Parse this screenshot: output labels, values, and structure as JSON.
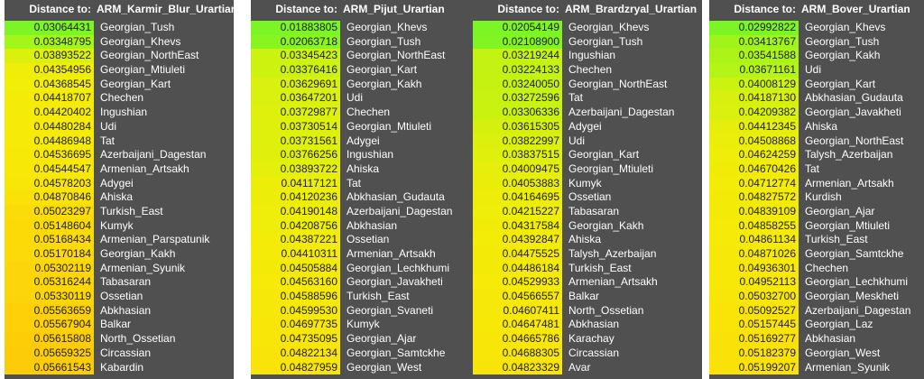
{
  "header_label": "Distance to:",
  "panels": [
    {
      "population": "ARM_Karmir_Blur_Urartian",
      "rows": [
        {
          "value": "0.03064431",
          "name": "Georgian_Tush",
          "color": "#7cf524"
        },
        {
          "value": "0.03348795",
          "name": "Georgian_Khevs",
          "color": "#a4f51a"
        },
        {
          "value": "0.03893522",
          "name": "Georgian_NorthEast",
          "color": "#dcf00e"
        },
        {
          "value": "0.04354956",
          "name": "Georgian_Mtiuleti",
          "color": "#f0ee08"
        },
        {
          "value": "0.04368545",
          "name": "Georgian_Kart",
          "color": "#f2ee08"
        },
        {
          "value": "0.04418707",
          "name": "Chechen",
          "color": "#f4ec08"
        },
        {
          "value": "0.04420402",
          "name": "Ingushian",
          "color": "#f4ec08"
        },
        {
          "value": "0.04480284",
          "name": "Udi",
          "color": "#f6ea08"
        },
        {
          "value": "0.04486948",
          "name": "Tat",
          "color": "#f6ea08"
        },
        {
          "value": "0.04536695",
          "name": "Azerbaijani_Dagestan",
          "color": "#f8e808"
        },
        {
          "value": "0.04544547",
          "name": "Armenian_Artsakh",
          "color": "#f8e808"
        },
        {
          "value": "0.04578203",
          "name": "Adygei",
          "color": "#f8e608"
        },
        {
          "value": "0.04870846",
          "name": "Ahiska",
          "color": "#fae208"
        },
        {
          "value": "0.05023297",
          "name": "Turkish_East",
          "color": "#fcdc08"
        },
        {
          "value": "0.05148604",
          "name": "Kumyk",
          "color": "#fcda08"
        },
        {
          "value": "0.05168434",
          "name": "Armenian_Parspatunik",
          "color": "#fcda08"
        },
        {
          "value": "0.05170184",
          "name": "Georgian_Kakh",
          "color": "#fcd908"
        },
        {
          "value": "0.05302119",
          "name": "Armenian_Syunik",
          "color": "#fcd608"
        },
        {
          "value": "0.05316244",
          "name": "Tabasaran",
          "color": "#fcd608"
        },
        {
          "value": "0.05330119",
          "name": "Ossetian",
          "color": "#fcd508"
        },
        {
          "value": "0.05563659",
          "name": "Abkhasian",
          "color": "#fdd008"
        },
        {
          "value": "0.05567904",
          "name": "Balkar",
          "color": "#fdd008"
        },
        {
          "value": "0.05615808",
          "name": "North_Ossetian",
          "color": "#fdce08"
        },
        {
          "value": "0.05659325",
          "name": "Circassian",
          "color": "#fdcc08"
        },
        {
          "value": "0.05661543",
          "name": "Kabardin",
          "color": "#fdcc08"
        }
      ]
    },
    {
      "population": "ARM_Pijut_Urartian",
      "rows": [
        {
          "value": "0.01883805",
          "name": "Georgian_Khevs",
          "color": "#7cf524"
        },
        {
          "value": "0.02063718",
          "name": "Georgian_Tush",
          "color": "#88f520"
        },
        {
          "value": "0.03345423",
          "name": "Georgian_NorthEast",
          "color": "#ccf210"
        },
        {
          "value": "0.03376416",
          "name": "Georgian_Kart",
          "color": "#cef210"
        },
        {
          "value": "0.03629691",
          "name": "Georgian_Kakh",
          "color": "#daf00e"
        },
        {
          "value": "0.03647201",
          "name": "Udi",
          "color": "#daf00e"
        },
        {
          "value": "0.03729877",
          "name": "Chechen",
          "color": "#def00c"
        },
        {
          "value": "0.03730514",
          "name": "Georgian_Mtiuleti",
          "color": "#def00c"
        },
        {
          "value": "0.03731561",
          "name": "Adygei",
          "color": "#def00c"
        },
        {
          "value": "0.03766256",
          "name": "Ingushian",
          "color": "#e0f00c"
        },
        {
          "value": "0.03893722",
          "name": "Ahiska",
          "color": "#e4f00c"
        },
        {
          "value": "0.04117121",
          "name": "Tat",
          "color": "#ecee0a"
        },
        {
          "value": "0.04120236",
          "name": "Abkhasian_Gudauta",
          "color": "#ecee0a"
        },
        {
          "value": "0.04190148",
          "name": "Azerbaijani_Dagestan",
          "color": "#eeee0a"
        },
        {
          "value": "0.04208756",
          "name": "Abkhasian",
          "color": "#eeee0a"
        },
        {
          "value": "0.04387221",
          "name": "Ossetian",
          "color": "#f2ec08"
        },
        {
          "value": "0.04410311",
          "name": "Armenian_Artsakh",
          "color": "#f4ec08"
        },
        {
          "value": "0.04505884",
          "name": "Georgian_Lechkhumi",
          "color": "#f4ea08"
        },
        {
          "value": "0.04563160",
          "name": "Georgian_Javakheti",
          "color": "#f6ea08"
        },
        {
          "value": "0.04588596",
          "name": "Turkish_East",
          "color": "#f6e808"
        },
        {
          "value": "0.04599530",
          "name": "Georgian_Svaneti",
          "color": "#f6e808"
        },
        {
          "value": "0.04697735",
          "name": "Kumyk",
          "color": "#f8e608"
        },
        {
          "value": "0.04735095",
          "name": "Georgian_Ajar",
          "color": "#f8e608"
        },
        {
          "value": "0.04822134",
          "name": "Georgian_Samtckhe",
          "color": "#f8e408"
        },
        {
          "value": "0.04827959",
          "name": "Georgian_West",
          "color": "#f8e408"
        }
      ]
    },
    {
      "population": "ARM_Brardzryal_Urartian",
      "rows": [
        {
          "value": "0.02054149",
          "name": "Georgian_Khevs",
          "color": "#7cf524"
        },
        {
          "value": "0.02108900",
          "name": "Georgian_Tush",
          "color": "#80f522"
        },
        {
          "value": "0.03219244",
          "name": "Ingushian",
          "color": "#c4f212"
        },
        {
          "value": "0.03224133",
          "name": "Chechen",
          "color": "#c4f212"
        },
        {
          "value": "0.03240050",
          "name": "Georgian_NorthEast",
          "color": "#c6f212"
        },
        {
          "value": "0.03272596",
          "name": "Tat",
          "color": "#c8f212"
        },
        {
          "value": "0.03306336",
          "name": "Azerbaijani_Dagestan",
          "color": "#caf210"
        },
        {
          "value": "0.03615305",
          "name": "Adygei",
          "color": "#d6f00e"
        },
        {
          "value": "0.03822997",
          "name": "Udi",
          "color": "#dcf00e"
        },
        {
          "value": "0.03837515",
          "name": "Georgian_Kart",
          "color": "#def00c"
        },
        {
          "value": "0.04009475",
          "name": "Georgian_Mtiuleti",
          "color": "#e6ee0c"
        },
        {
          "value": "0.04053883",
          "name": "Kumyk",
          "color": "#e8ee0a"
        },
        {
          "value": "0.04164695",
          "name": "Ossetian",
          "color": "#ecee0a"
        },
        {
          "value": "0.04215227",
          "name": "Tabasaran",
          "color": "#eeee0a"
        },
        {
          "value": "0.04317584",
          "name": "Georgian_Kakh",
          "color": "#f0ec08"
        },
        {
          "value": "0.04392847",
          "name": "Ahiska",
          "color": "#f2ec08"
        },
        {
          "value": "0.04475525",
          "name": "Talysh_Azerbaijan",
          "color": "#f4ea08"
        },
        {
          "value": "0.04486184",
          "name": "Turkish_East",
          "color": "#f4ea08"
        },
        {
          "value": "0.04529933",
          "name": "Armenian_Artsakh",
          "color": "#f6ea08"
        },
        {
          "value": "0.04566557",
          "name": "Balkar",
          "color": "#f6e808"
        },
        {
          "value": "0.04607411",
          "name": "North_Ossetian",
          "color": "#f6e808"
        },
        {
          "value": "0.04647481",
          "name": "Abkhasian",
          "color": "#f8e808"
        },
        {
          "value": "0.04665786",
          "name": "Karachay",
          "color": "#f8e608"
        },
        {
          "value": "0.04688305",
          "name": "Circassian",
          "color": "#f8e608"
        },
        {
          "value": "0.04823329",
          "name": "Avar",
          "color": "#f8e408"
        }
      ]
    },
    {
      "population": "ARM_Bover_Urartian",
      "rows": [
        {
          "value": "0.02992822",
          "name": "Georgian_Khevs",
          "color": "#7cf524"
        },
        {
          "value": "0.03413767",
          "name": "Georgian_Tush",
          "color": "#a0f41a"
        },
        {
          "value": "0.03541588",
          "name": "Georgian_Kakh",
          "color": "#acf418"
        },
        {
          "value": "0.03671161",
          "name": "Udi",
          "color": "#b4f416"
        },
        {
          "value": "0.04008129",
          "name": "Georgian_Kart",
          "color": "#ccf210"
        },
        {
          "value": "0.04187130",
          "name": "Abkhasian_Gudauta",
          "color": "#d8f00e"
        },
        {
          "value": "0.04209382",
          "name": "Georgian_Javakheti",
          "color": "#daf00e"
        },
        {
          "value": "0.04412345",
          "name": "Ahiska",
          "color": "#e6ee0c"
        },
        {
          "value": "0.04508868",
          "name": "Georgian_NorthEast",
          "color": "#eaee0a"
        },
        {
          "value": "0.04624259",
          "name": "Talysh_Azerbaijan",
          "color": "#eeee0a"
        },
        {
          "value": "0.04670426",
          "name": "Tat",
          "color": "#f0ec08"
        },
        {
          "value": "0.04712774",
          "name": "Armenian_Artsakh",
          "color": "#f2ec08"
        },
        {
          "value": "0.04827572",
          "name": "Kurdish",
          "color": "#f4ea08"
        },
        {
          "value": "0.04839109",
          "name": "Georgian_Ajar",
          "color": "#f4ea08"
        },
        {
          "value": "0.04858255",
          "name": "Georgian_Mtiuleti",
          "color": "#f6ea08"
        },
        {
          "value": "0.04861134",
          "name": "Turkish_East",
          "color": "#f6ea08"
        },
        {
          "value": "0.04871026",
          "name": "Georgian_Samtckhe",
          "color": "#f6e808"
        },
        {
          "value": "0.04936301",
          "name": "Chechen",
          "color": "#f8e808"
        },
        {
          "value": "0.04952113",
          "name": "Georgian_Lechkhumi",
          "color": "#f8e808"
        },
        {
          "value": "0.05032700",
          "name": "Georgian_Meskheti",
          "color": "#f8e608"
        },
        {
          "value": "0.05092527",
          "name": "Azerbaijani_Dagestan",
          "color": "#fae408"
        },
        {
          "value": "0.05157445",
          "name": "Georgian_Laz",
          "color": "#fae408"
        },
        {
          "value": "0.05169277",
          "name": "Abkhasian",
          "color": "#fae208"
        },
        {
          "value": "0.05182379",
          "name": "Georgian_West",
          "color": "#fae208"
        },
        {
          "value": "0.05199207",
          "name": "Armenian_Syunik",
          "color": "#fae208"
        }
      ]
    }
  ]
}
